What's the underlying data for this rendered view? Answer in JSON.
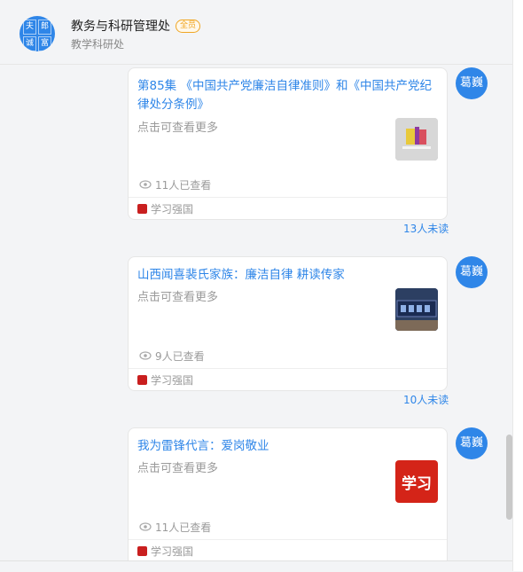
{
  "header": {
    "avatar_chars": [
      "夫",
      "郎",
      "诚",
      "富"
    ],
    "title": "教务与科研管理处",
    "badge": "全员",
    "subtitle": "教学科研处"
  },
  "messages": [
    {
      "title": "第85集 《中国共产党廉洁自律准则》和《中国共产党纪律处分条例》",
      "desc": "点击可查看更多",
      "views": "11人已查看",
      "source": "学习强国",
      "unread": "13人未读",
      "sender": "葛巍",
      "thumb_icon": "book-thumbnail"
    },
    {
      "title": "山西闻喜裴氏家族：廉洁自律 耕读传家",
      "desc": "点击可查看更多",
      "views": "9人已查看",
      "source": "学习强国",
      "unread": "10人未读",
      "sender": "葛巍",
      "thumb_icon": "plaque-thumbnail"
    },
    {
      "title": "我为雷锋代言：爱岗敬业",
      "desc": "点击可查看更多",
      "views": "11人已查看",
      "source": "学习强国",
      "sender": "葛巍",
      "thumb_icon": "xuexi-logo-thumbnail",
      "thumb_text": "学习"
    }
  ],
  "colors": {
    "accent": "#2f86e8",
    "badge": "#f0a623",
    "source_logo": "#c91f1f"
  }
}
